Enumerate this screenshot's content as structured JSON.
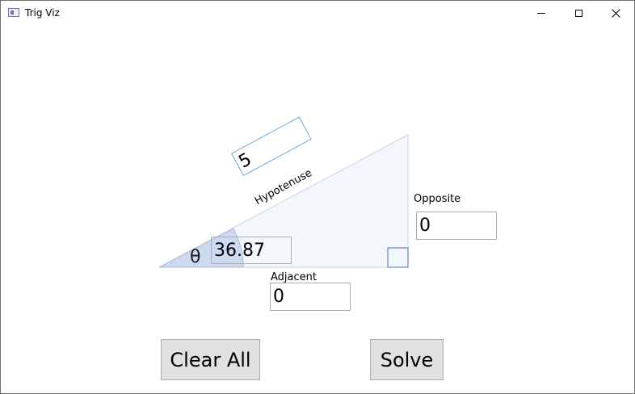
{
  "window": {
    "title": "Trig Viz"
  },
  "triangle": {
    "theta_symbol": "θ",
    "angle_value": "36.87",
    "hypotenuse_label": "Hypotenuse",
    "hypotenuse_value": "5",
    "opposite_label": "Opposite",
    "opposite_value": "0",
    "adjacent_label": "Adjacent",
    "adjacent_value": "0"
  },
  "buttons": {
    "clear_all": "Clear All",
    "solve": "Solve"
  },
  "colors": {
    "triangle_fill": "#f3f6fb",
    "triangle_stroke": "#c8d4e6",
    "angle_arc_fill": "#cdd9ee",
    "hypotenuse_border": "#6fa8dc",
    "button_face": "#e1e1e1"
  },
  "icons": {
    "app": "app-window-icon",
    "minimize": "minimize-icon",
    "maximize": "maximize-icon",
    "close": "close-icon"
  }
}
